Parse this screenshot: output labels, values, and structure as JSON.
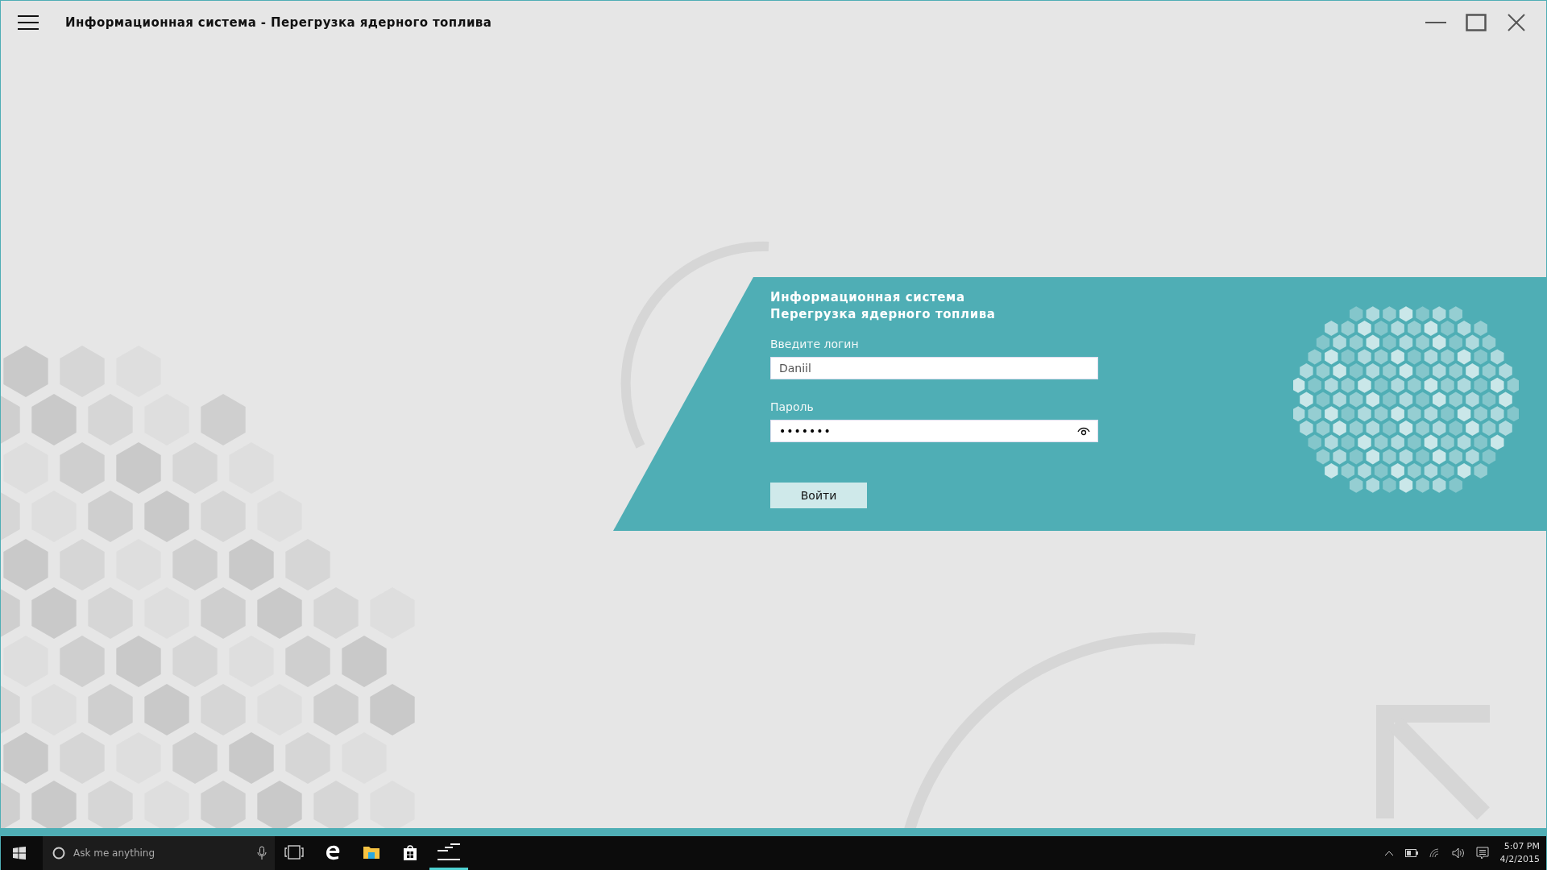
{
  "window": {
    "title": "Информационная система - Перегрузка ядерного топлива"
  },
  "login": {
    "heading": [
      "Информационная система",
      "Перегрузка ядерного топлива"
    ],
    "fields": [
      {
        "kind": "text",
        "label": "Введите логин",
        "value": "Daniil"
      },
      {
        "kind": "password",
        "label": "Пароль",
        "value": "•••••••"
      }
    ],
    "button": "Войти"
  },
  "taskbar": {
    "search": {
      "placeholder": "Ask me anything"
    },
    "apps": [
      {
        "kind": "edge",
        "selected": false
      },
      {
        "kind": "explorer",
        "selected": false
      },
      {
        "kind": "store",
        "selected": false
      },
      {
        "kind": "app",
        "selected": true
      }
    ],
    "clock": {
      "time": "5:07 PM",
      "date": "4/2/2015"
    }
  }
}
